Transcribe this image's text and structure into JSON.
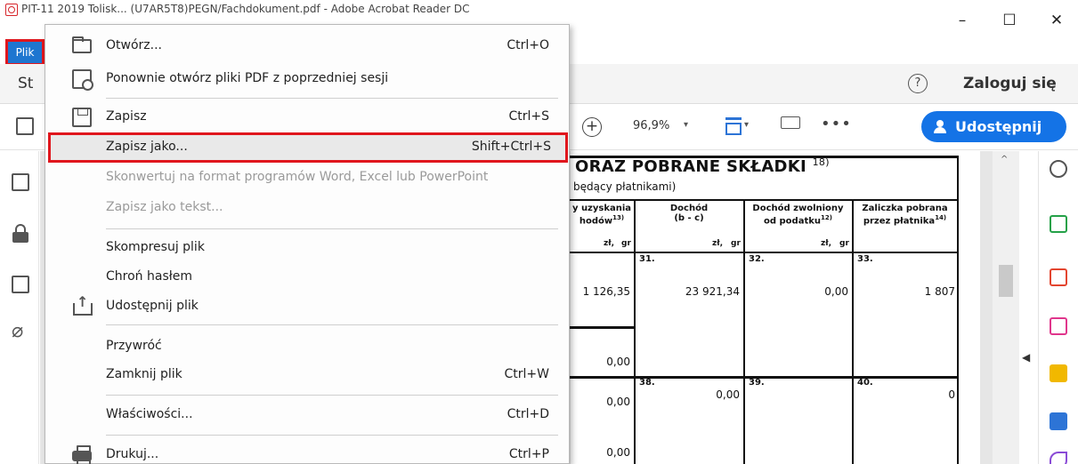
{
  "window": {
    "title": "PIT-11 2019 Tolisk... (U7AR5T8)PEGN/Fachdokument.pdf - Adobe Acrobat Reader DC",
    "minimize": "–",
    "maximize": "☐",
    "close": "✕"
  },
  "menubar": {
    "file_label": "Plik"
  },
  "tabs": {
    "partial_tab": "St",
    "help": "?",
    "login": "Zaloguj się"
  },
  "toolbar": {
    "zoom_in": "+",
    "zoom_value": "96,9%",
    "caret": "▾",
    "more": "•••",
    "share_label": "Udostępnij"
  },
  "file_menu": {
    "items": [
      {
        "label": "Otwórz...",
        "shortcut": "Ctrl+O",
        "icon": "folder-open-icon"
      },
      {
        "label": "Ponownie otwórz pliki PDF z poprzedniej sesji",
        "shortcut": "",
        "icon": "reopen-icon"
      },
      {
        "label": "Zapisz",
        "shortcut": "Ctrl+S",
        "icon": "save-icon"
      },
      {
        "label": "Zapisz jako...",
        "shortcut": "Shift+Ctrl+S",
        "icon": ""
      },
      {
        "label": "Skonwertuj na format programów Word, Excel lub PowerPoint",
        "shortcut": "",
        "icon": ""
      },
      {
        "label": "Zapisz jako tekst...",
        "shortcut": "",
        "icon": ""
      },
      {
        "label": "Skompresuj plik",
        "shortcut": "",
        "icon": ""
      },
      {
        "label": "Chroń hasłem",
        "shortcut": "",
        "icon": ""
      },
      {
        "label": "Udostępnij plik",
        "shortcut": "",
        "icon": "share-file-icon"
      },
      {
        "label": "Przywróć",
        "shortcut": "",
        "icon": ""
      },
      {
        "label": "Zamknij plik",
        "shortcut": "Ctrl+W",
        "icon": ""
      },
      {
        "label": "Właściwości...",
        "shortcut": "Ctrl+D",
        "icon": ""
      },
      {
        "label": "Drukuj...",
        "shortcut": "Ctrl+P",
        "icon": "printer-icon"
      }
    ]
  },
  "document": {
    "heading": "ORAZ POBRANE SKŁADKI",
    "heading_ref": "18)",
    "subheading": "będący płatnikami)",
    "columns": [
      {
        "line1": "y uzyskania",
        "line2": "hodów",
        "ref": "13)"
      },
      {
        "line1": "Dochód",
        "line2": "(b - c)",
        "ref": ""
      },
      {
        "line1": "Dochód zwolniony",
        "line2": "od podatku",
        "ref": "12)"
      },
      {
        "line1": "Zaliczka pobrana",
        "line2": "przez płatnika",
        "ref": "14)"
      }
    ],
    "unit_zl": "zł,",
    "unit_gr": "gr",
    "cell_numbers": [
      "31.",
      "32.",
      "33.",
      "38.",
      "39.",
      "40."
    ],
    "values": {
      "r1c0": "1 126,35",
      "r1c1": "23 921,34",
      "r1c2": "0,00",
      "r1c3": "1 807",
      "r2c0": "0,00",
      "r3c0": "0,00",
      "r3c1": "0,00",
      "r3c3": "0",
      "r4c0": "0,00"
    }
  },
  "scrollbar": {
    "up": "^",
    "toggle": "◀"
  }
}
